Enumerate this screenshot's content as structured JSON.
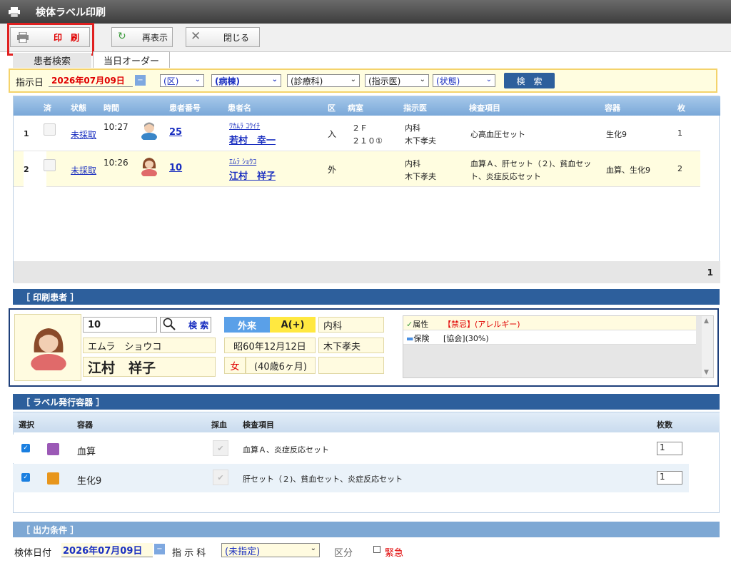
{
  "window": {
    "title": "検体ラベル印刷"
  },
  "toolbar": {
    "print_label": "印　刷",
    "refresh_label": "再表示",
    "close_label": "閉じる"
  },
  "tabs": [
    {
      "label": "患者検索"
    },
    {
      "label": "当日オーダー"
    }
  ],
  "filter": {
    "date_label": "指示日",
    "date_value": "2026年07月09日",
    "ward_area": "(区)",
    "ward": "(病棟)",
    "dept": "(診療科)",
    "doctor": "(指示医)",
    "status": "(状態)",
    "search_label": "検　索"
  },
  "orders": {
    "columns": [
      "済",
      "状態",
      "時間",
      "患者番号",
      "患者名",
      "区",
      "病室",
      "指示医",
      "検査項目",
      "容器",
      "枚"
    ],
    "rows": [
      {
        "no": "1",
        "status": "未採取",
        "time": "10:27",
        "patient_id": "25",
        "kana": "ﾜｶﾑﾗ ｺｳｲﾁ",
        "name": "若村　幸一",
        "kubun": "入",
        "room1": "２Ｆ",
        "room2": "２１０①",
        "dept": "内科",
        "doctor": "木下孝夫",
        "tests": "心高血圧セット",
        "container": "生化9",
        "count": "1"
      },
      {
        "no": "2",
        "status": "未採取",
        "time": "10:26",
        "patient_id": "10",
        "kana": "ｴﾑﾗ ｼｮｳｺ",
        "name": "江村　祥子",
        "kubun": "外",
        "room1": "",
        "room2": "",
        "dept": "内科",
        "doctor": "木下孝夫",
        "tests": "血算Ａ、肝セット（２)、貧血セット、炎症反応セット",
        "container": "血算、生化9",
        "count": "2"
      }
    ],
    "page": "1"
  },
  "print_patient": {
    "section_title": "［ 印刷患者 ］",
    "patient_id": "10",
    "search_label": "検 索",
    "kana": "エムラ　ショウコ",
    "name": "江村　祥子",
    "visit_type": "外来",
    "blood_type": "A(+)",
    "dept": "内科",
    "birth": "昭60年12月12日",
    "doctor": "木下孝夫",
    "sex": "女",
    "age": "(40歳6ヶ月)",
    "info": [
      {
        "label": "属性",
        "value": "【禁忌】(アレルギー)"
      },
      {
        "label": "保険",
        "value": "[協会](30%)"
      }
    ]
  },
  "labels": {
    "section_title": "［ ラベル発行容器 ］",
    "columns": [
      "選択",
      "容器",
      "採血",
      "検査項目",
      "枚数"
    ],
    "rows": [
      {
        "container": "血算",
        "color": "#9b59b6",
        "tests": "血算Ａ、炎症反応セット",
        "count": "1"
      },
      {
        "container": "生化9",
        "color": "#e8961c",
        "tests": "肝セット（２)、貧血セット、炎症反応セット",
        "count": "1"
      }
    ]
  },
  "output": {
    "section_title": "［ 出力条件 ］",
    "date_label": "検体日付",
    "date_value": "2026年07月09日",
    "dept_label": "指 示 科",
    "dept_value": "(未指定)",
    "kubun_label": "区分",
    "urgent_label": "緊急"
  }
}
